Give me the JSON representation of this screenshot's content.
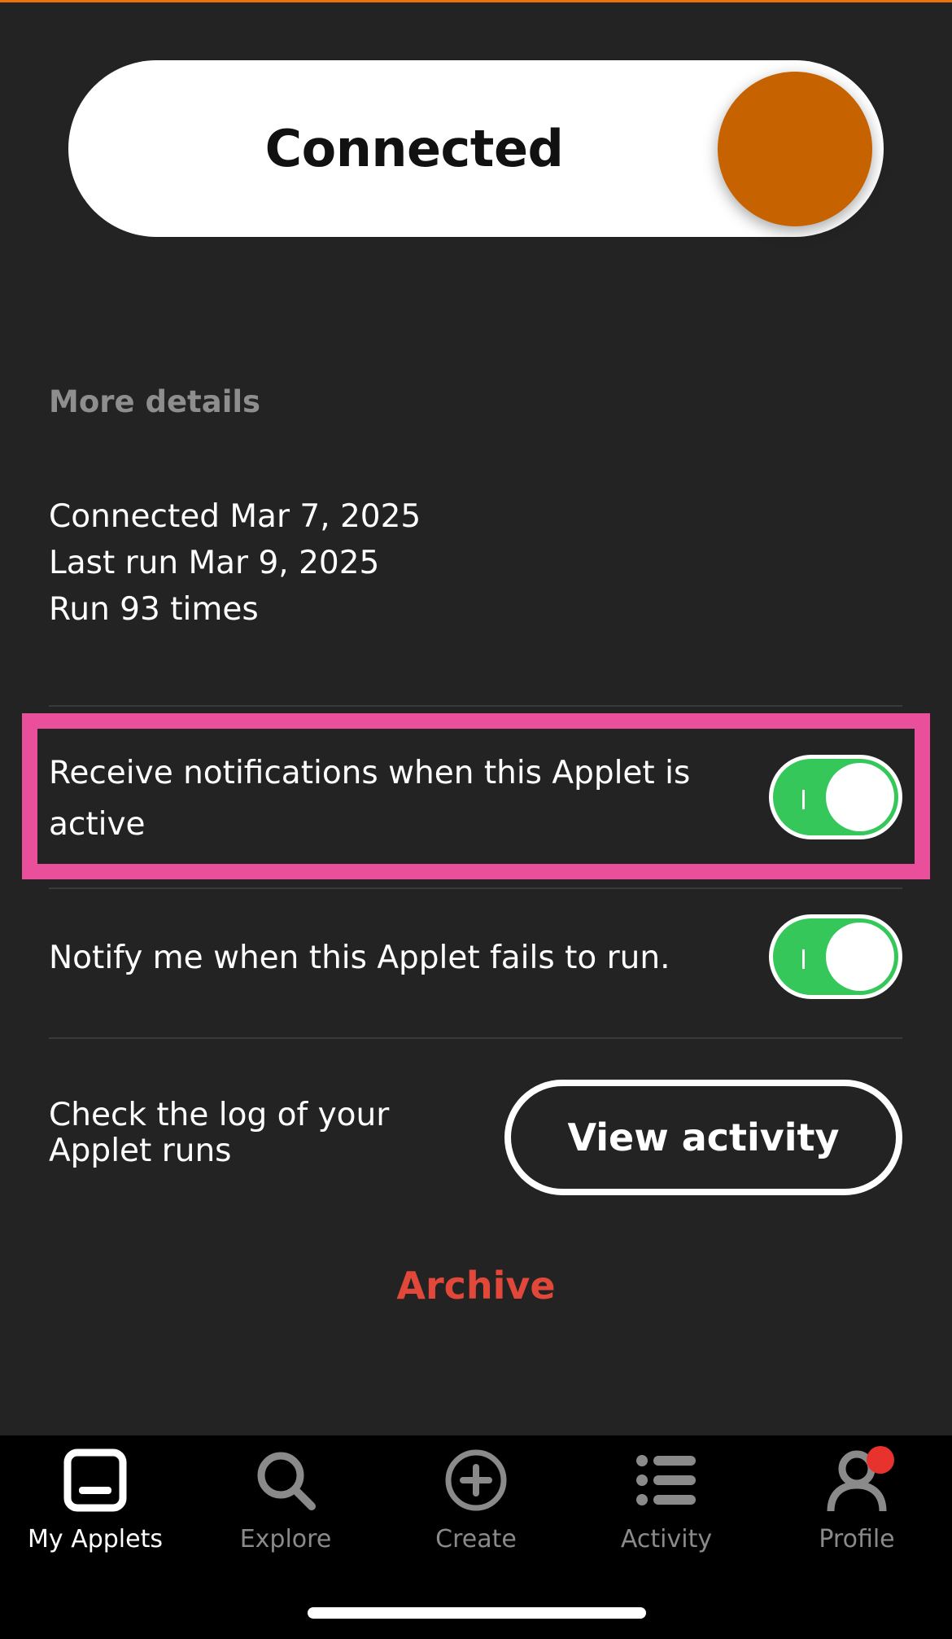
{
  "connection": {
    "status_label": "Connected"
  },
  "details": {
    "section_title": "More details",
    "connected": "Connected Mar 7, 2025",
    "last_run": "Last run Mar 9, 2025",
    "run_count": "Run 93 times"
  },
  "settings": [
    {
      "label": "Receive notifications when this Applet is active",
      "enabled": true
    },
    {
      "label": "Notify me when this Applet fails to run.",
      "enabled": true
    }
  ],
  "log": {
    "description": "Check the log of your Applet runs",
    "button_label": "View activity"
  },
  "archive_label": "Archive",
  "tabbar": {
    "tabs": [
      {
        "label": "My Applets",
        "icon": "my-applets-icon",
        "active": true
      },
      {
        "label": "Explore",
        "icon": "search-icon",
        "active": false
      },
      {
        "label": "Create",
        "icon": "plus-circle-icon",
        "active": false
      },
      {
        "label": "Activity",
        "icon": "list-icon",
        "active": false
      },
      {
        "label": "Profile",
        "icon": "profile-icon",
        "active": false,
        "badge": true
      }
    ]
  },
  "colors": {
    "background": "#232323",
    "accent_orange": "#c66200",
    "toggle_green": "#35c75a",
    "archive_red": "#e2483a",
    "highlight_pink": "#ea4f9c",
    "badge_red": "#e8322e"
  }
}
